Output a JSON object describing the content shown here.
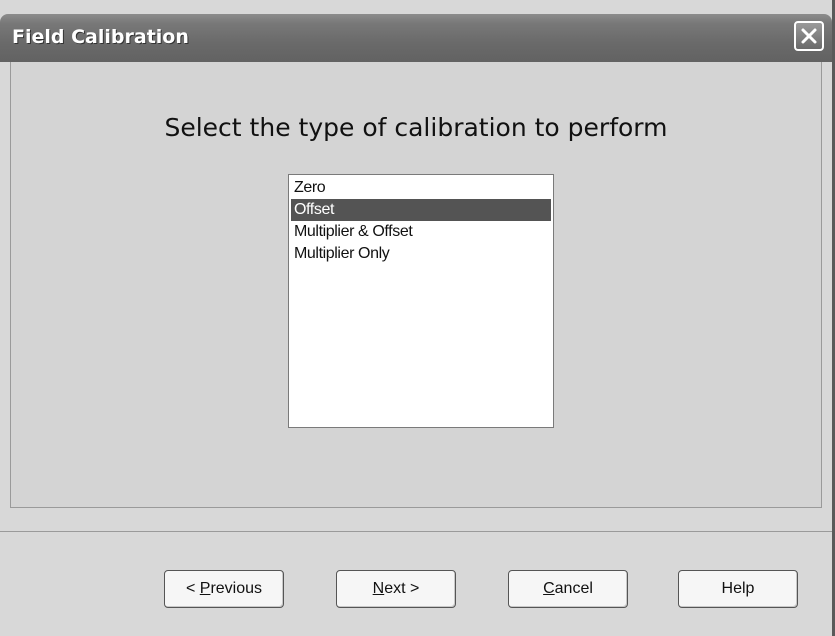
{
  "window": {
    "title": "Field Calibration",
    "close_icon": "close-icon"
  },
  "main": {
    "heading": "Select the type of calibration to perform",
    "calibration_types": [
      {
        "label": "Zero",
        "selected": false
      },
      {
        "label": "Offset",
        "selected": true
      },
      {
        "label": "Multiplier & Offset",
        "selected": false
      },
      {
        "label": "Multiplier Only",
        "selected": false
      }
    ]
  },
  "buttons": {
    "previous": {
      "prefix": "< ",
      "mnemonic": "P",
      "rest": "revious"
    },
    "next": {
      "mnemonic": "N",
      "rest": "ext >"
    },
    "cancel": {
      "mnemonic": "C",
      "rest": "ancel"
    },
    "help": {
      "label": "Help"
    }
  },
  "colors": {
    "selection_background": "#545454",
    "titlebar": "#6a6a6a"
  }
}
